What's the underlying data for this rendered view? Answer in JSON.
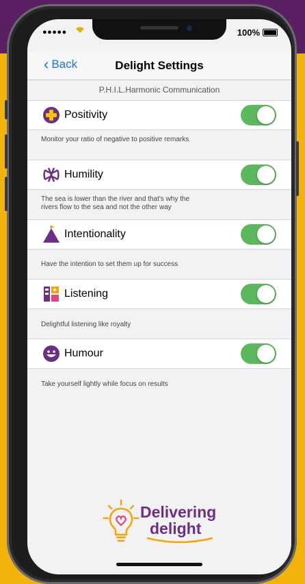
{
  "status": {
    "battery": "100%"
  },
  "nav": {
    "back": "Back",
    "title": "Delight Settings"
  },
  "section_header": "P.H.I.L.Harmonic Communication",
  "settings": [
    {
      "label": "Positivity",
      "icon": "plus-circle-icon",
      "enabled": true,
      "description": "Monitor your ratio of negative to positive remarks"
    },
    {
      "label": "Humility",
      "icon": "knot-icon",
      "enabled": true,
      "description": "The sea is lower than the river and that's why the rivers flow to the sea and not the other way"
    },
    {
      "label": "Intentionality",
      "icon": "mountain-flag-icon",
      "enabled": true,
      "description": "Have the intention to set them up for success"
    },
    {
      "label": "Listening",
      "icon": "listen-character-icon",
      "enabled": true,
      "description": "Delightful listening like royalty"
    },
    {
      "label": "Humour",
      "icon": "smile-icon",
      "enabled": true,
      "description": "Take yourself lightly while focus on results"
    }
  ],
  "logo": {
    "line1": "Delivering",
    "line2": "delight"
  },
  "colors": {
    "brand_purple": "#6b2f86",
    "toggle_on": "#5cb85c",
    "link_blue": "#1a73e8",
    "background_gold": "#f2b40a"
  }
}
